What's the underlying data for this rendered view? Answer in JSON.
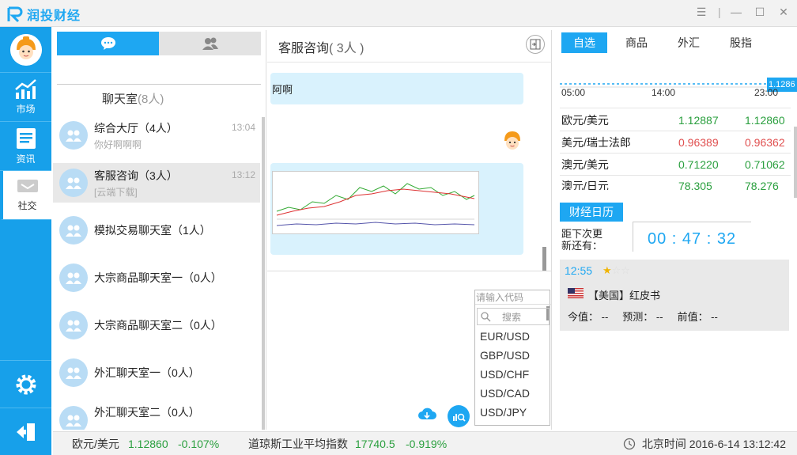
{
  "app": {
    "title": "润投财经",
    "colors": {
      "accent": "#1ea7f2",
      "up": "#2a9f3e",
      "down": "#e05050"
    }
  },
  "window_controls": [
    "menu-icon",
    "separator",
    "minimize-icon",
    "maximize-icon",
    "close-icon"
  ],
  "nav": {
    "items": [
      {
        "label": "市场",
        "icon": "market-chart-icon"
      },
      {
        "label": "资讯",
        "icon": "news-doc-icon"
      },
      {
        "label": "社交",
        "icon": "chat-icon",
        "active": true
      }
    ],
    "bottom": [
      "gear-icon",
      "exit-icon"
    ]
  },
  "roomlist": {
    "tabs": [
      "chat-bubbles-icon",
      "contacts-icon"
    ],
    "header": {
      "label": "聊天室",
      "count": "(8人)"
    },
    "rooms": [
      {
        "name": "综合大厅（4人）",
        "time": "13:04",
        "msg": "你好啊啊啊"
      },
      {
        "name": "客服咨询（3人）",
        "time": "13:12",
        "msg": "[云端下载]",
        "selected": true
      },
      {
        "name": "模拟交易聊天室（1人）",
        "time": "",
        "msg": ""
      },
      {
        "name": "大宗商品聊天室一（0人）",
        "time": "",
        "msg": ""
      },
      {
        "name": "大宗商品聊天室二（0人）",
        "time": "",
        "msg": ""
      },
      {
        "name": "外汇聊天室一（0人）",
        "time": "",
        "msg": ""
      },
      {
        "name": "外汇聊天室二（0人）",
        "time": "",
        "msg": ""
      }
    ]
  },
  "chat": {
    "title": "客服咨询",
    "count": "( 3人 )",
    "messages": [
      {
        "text": "阿啊"
      }
    ]
  },
  "code_popup": {
    "hint": "请输入代码",
    "search_placeholder": "搜索",
    "options": [
      "EUR/USD",
      "GBP/USD",
      "USD/CHF",
      "USD/CAD",
      "USD/JPY"
    ]
  },
  "right": {
    "tabs": [
      "自选",
      "商品",
      "外汇",
      "股指"
    ],
    "price_tag": "1.1286",
    "time_axis": [
      "05:00",
      "14:00",
      "23:00"
    ],
    "quotes": [
      {
        "name": "欧元/美元",
        "v1": "1.12887",
        "v2": "1.12860",
        "dir": "up"
      },
      {
        "name": "美元/瑞士法郎",
        "v1": "0.96389",
        "v2": "0.96362",
        "dir": "down"
      },
      {
        "name": "澳元/美元",
        "v1": "0.71220",
        "v2": "0.71062",
        "dir": "up"
      },
      {
        "name": "澳元/日元",
        "v1": "78.305",
        "v2": "78.276",
        "dir": "up"
      }
    ],
    "calendar_btn": "财经日历",
    "countdown_label": "距下次更新还有：",
    "countdown": "00 : 47 : 32",
    "event": {
      "time": "12:55",
      "stars": "★☆☆",
      "title": "【美国】红皮书",
      "today": "今值： --",
      "forecast": "预测： --",
      "prev": "前值： --"
    }
  },
  "status": {
    "q1": {
      "name": "欧元/美元",
      "price": "1.12860",
      "chg": "-0.107%"
    },
    "q2": {
      "name": "道琼斯工业平均指数",
      "price": "17740.5",
      "chg": "-0.919%"
    },
    "time": "北京时间 2016-6-14 13:12:42"
  }
}
